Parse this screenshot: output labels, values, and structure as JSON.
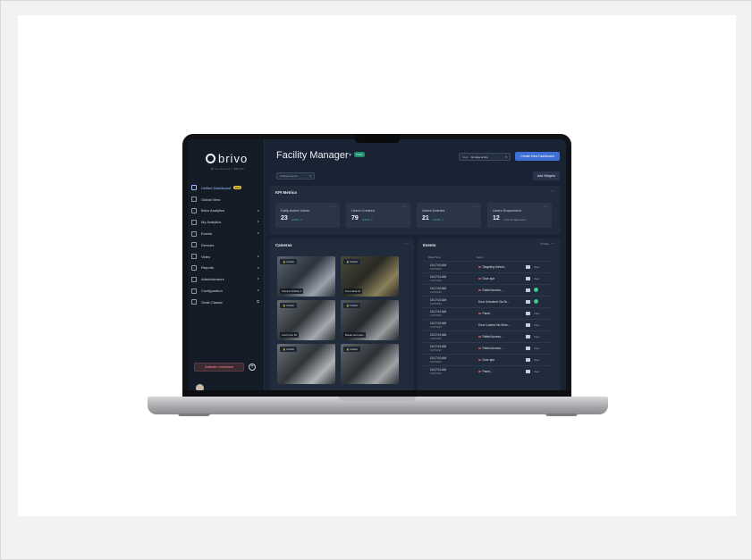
{
  "sidebar": {
    "logo": "brivo",
    "logo_sub": "Brivo Access | BRIVO",
    "items": [
      {
        "label": "Unified Dashboard",
        "icon": "dashboard-icon",
        "badge": "Beta",
        "active": true
      },
      {
        "label": "Global View",
        "icon": "globe-icon"
      },
      {
        "label": "Brivo Analytics",
        "icon": "analytics-icon",
        "arrow": "▸"
      },
      {
        "label": "My Analytics",
        "icon": "chart-icon",
        "arrow": "▸"
      },
      {
        "label": "Events",
        "icon": "events-icon",
        "arrow": "▸"
      },
      {
        "label": "Devices",
        "icon": "devices-icon"
      },
      {
        "label": "Video",
        "icon": "video-icon",
        "arrow": "▸"
      },
      {
        "label": "Reports",
        "icon": "reports-icon",
        "arrow": "▸"
      },
      {
        "label": "Administrators",
        "icon": "admin-icon",
        "arrow": "▸"
      },
      {
        "label": "Configuration",
        "icon": "config-icon",
        "arrow": "▸"
      },
      {
        "label": "Onair Classic",
        "icon": "classic-icon",
        "arrow": "⧉"
      }
    ],
    "lockdown_label": "Activate Lockdown"
  },
  "header": {
    "title": "Facility Manager",
    "badge": "Public",
    "site_label": "Sites",
    "site_value": "All sites active",
    "create_button": "Create New Dashboard",
    "change_layout": "Change layout",
    "add_widgets": "Add Widgets"
  },
  "kpi": {
    "title": "KPI Metrics",
    "cards": [
      {
        "label": "Daily Active Users",
        "value": "23",
        "delta": "0.63% ↗"
      },
      {
        "label": "Users Created",
        "value": "79",
        "delta": "0.63% ↗"
      },
      {
        "label": "Users Deleted",
        "value": "21",
        "delta": "0.63% ↗"
      },
      {
        "label": "Users Suspended",
        "value": "12",
        "delta": "1.0% of total users"
      }
    ]
  },
  "cameras": {
    "title": "Cameras",
    "tiles": [
      {
        "unlock": "Unlock",
        "name": "Camera Kitchen 1"
      },
      {
        "unlock": "Unlock",
        "name": "Front desk 01"
      },
      {
        "unlock": "Unlock",
        "name": "Conf room 02"
      },
      {
        "unlock": "Unlock",
        "name": "Break room cam"
      },
      {
        "unlock": "Unlock",
        "name": ""
      },
      {
        "unlock": "Unlock",
        "name": ""
      }
    ]
  },
  "events": {
    "title": "Events",
    "filter": "Filter",
    "col_date": "Date/Time",
    "col_event": "Event",
    "rows": [
      {
        "time": "10:17:10 AM",
        "date": "11/07/2022",
        "desc": "Targeting Detect...",
        "dot": true,
        "action": "View"
      },
      {
        "time": "10:17:10 AM",
        "date": "11/07/2022",
        "desc": "Door ajar",
        "dot": true,
        "action": "View"
      },
      {
        "time": "10:17:10 AM",
        "date": "11/07/2022",
        "desc": "Failed Access...",
        "dot": true,
        "action": "check"
      },
      {
        "time": "10:17:10 AM",
        "date": "11/07/2022",
        "desc": "Door Unlocked Via Sc...",
        "dot": false,
        "action": "check"
      },
      {
        "time": "10:17:10 AM",
        "date": "11/07/2022",
        "desc": "Panel...",
        "dot": true,
        "action": "View"
      },
      {
        "time": "10:17:10 AM",
        "date": "11/07/2022",
        "desc": "Door Locked Via Sche...",
        "dot": false,
        "action": "View"
      },
      {
        "time": "10:17:10 AM",
        "date": "11/07/2022",
        "desc": "Failed Access...",
        "dot": true,
        "action": "View"
      },
      {
        "time": "10:17:10 AM",
        "date": "11/07/2022",
        "desc": "Failed Access...",
        "dot": true,
        "action": "View"
      },
      {
        "time": "10:17:10 AM",
        "date": "11/07/2022",
        "desc": "Door ajar",
        "dot": true,
        "action": "View"
      },
      {
        "time": "10:17:10 AM",
        "date": "11/07/2022",
        "desc": "Panel...",
        "dot": true,
        "action": "View"
      }
    ]
  },
  "colors": {
    "accent": "#3d6fd6",
    "sidebar_bg": "#141c28",
    "panel_bg": "#202b3b",
    "success": "#35c28a",
    "alert": "#d24a4a"
  }
}
